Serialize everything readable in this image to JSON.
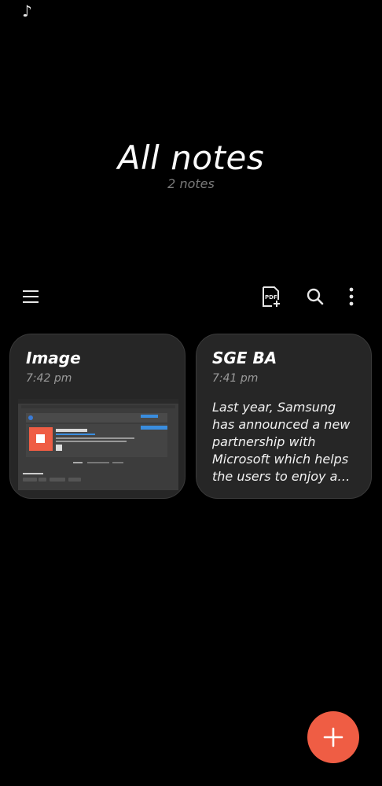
{
  "status_bar": {
    "icon": "music-note-icon",
    "glyph": "♪"
  },
  "header": {
    "title": "All notes",
    "count": "2 notes"
  },
  "toolbar": {
    "menu_icon": "hamburger-menu-icon",
    "pdf_icon": "pdf-import-icon",
    "search_icon": "search-icon",
    "more_icon": "more-options-icon"
  },
  "notes": [
    {
      "title": "Image",
      "time": "7:42 pm",
      "thumbnail": "screenshot-thumbnail"
    },
    {
      "title": "SGE BA",
      "time": "7:41 pm",
      "preview": "Last year,  Samsung has announced a new partnership with Microsoft which helps the users to enjoy a seamless experience"
    }
  ],
  "fab": {
    "icon": "plus-icon"
  },
  "colors": {
    "accent": "#ef5d44",
    "card": "#262626",
    "background": "#000000"
  }
}
